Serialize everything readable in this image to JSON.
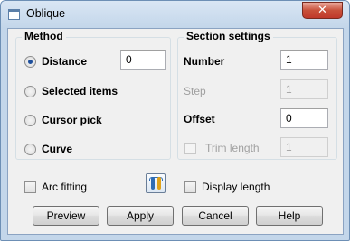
{
  "window": {
    "title": "Oblique",
    "close_glyph": "✕"
  },
  "method": {
    "legend": "Method",
    "options": [
      {
        "label": "Distance",
        "checked": true
      },
      {
        "label": "Selected items",
        "checked": false
      },
      {
        "label": "Cursor pick",
        "checked": false
      },
      {
        "label": "Curve",
        "checked": false
      }
    ],
    "distance_value": "0"
  },
  "section_settings": {
    "legend": "Section settings",
    "number_label": "Number",
    "number_value": "1",
    "step_label": "Step",
    "step_value": "1",
    "offset_label": "Offset",
    "offset_value": "0",
    "trim_length_label": "Trim length",
    "trim_length_value": "1"
  },
  "arc_fitting_label": "Arc fitting",
  "display_length_label": "Display length",
  "buttons": {
    "preview": "Preview",
    "apply": "Apply",
    "cancel": "Cancel",
    "help": "Help"
  },
  "colors": {
    "accent": "#1e4f9b",
    "close": "#c0392b"
  }
}
